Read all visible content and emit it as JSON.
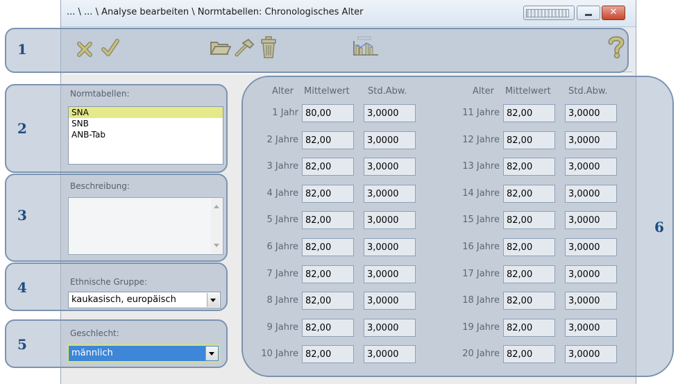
{
  "window": {
    "title": "... \\ ... \\ Analyse bearbeiten \\ Normtabellen: Chronologisches Alter",
    "close_label": "✕"
  },
  "toolbar": {
    "icons": [
      "cancel-x-icon",
      "confirm-check-icon",
      "open-folder-icon",
      "hammer-icon",
      "trash-icon",
      "chart-icon",
      "help-icon"
    ]
  },
  "callouts": [
    "1",
    "2",
    "3",
    "4",
    "5",
    "6"
  ],
  "norm_tables": {
    "label": "Normtabellen:",
    "items": [
      "SNA",
      "SNB",
      "ANB-Tab"
    ],
    "selected": "SNA"
  },
  "description": {
    "label": "Beschreibung:",
    "value": ""
  },
  "ethnic_group": {
    "label": "Ethnische Gruppe:",
    "value": "kaukasisch, europäisch"
  },
  "gender": {
    "label": "Geschlecht:",
    "value": "männlich"
  },
  "table": {
    "headers": {
      "age": "Alter",
      "mean": "Mittelwert",
      "sd": "Std.Abw."
    },
    "left": [
      {
        "age": "1 Jahr",
        "mean": "80,00",
        "sd": "3,0000"
      },
      {
        "age": "2 Jahre",
        "mean": "82,00",
        "sd": "3,0000"
      },
      {
        "age": "3 Jahre",
        "mean": "82,00",
        "sd": "3,0000"
      },
      {
        "age": "4 Jahre",
        "mean": "82,00",
        "sd": "3,0000"
      },
      {
        "age": "5 Jahre",
        "mean": "82,00",
        "sd": "3,0000"
      },
      {
        "age": "6 Jahre",
        "mean": "82,00",
        "sd": "3,0000"
      },
      {
        "age": "7 Jahre",
        "mean": "82,00",
        "sd": "3,0000"
      },
      {
        "age": "8 Jahre",
        "mean": "82,00",
        "sd": "3,0000"
      },
      {
        "age": "9 Jahre",
        "mean": "82,00",
        "sd": "3,0000"
      },
      {
        "age": "10 Jahre",
        "mean": "82,00",
        "sd": "3,0000"
      }
    ],
    "right": [
      {
        "age": "11 Jahre",
        "mean": "82,00",
        "sd": "3,0000"
      },
      {
        "age": "12 Jahre",
        "mean": "82,00",
        "sd": "3,0000"
      },
      {
        "age": "13 Jahre",
        "mean": "82,00",
        "sd": "3,0000"
      },
      {
        "age": "14 Jahre",
        "mean": "82,00",
        "sd": "3,0000"
      },
      {
        "age": "15 Jahre",
        "mean": "82,00",
        "sd": "3,0000"
      },
      {
        "age": "16 Jahre",
        "mean": "82,00",
        "sd": "3,0000"
      },
      {
        "age": "17 Jahre",
        "mean": "82,00",
        "sd": "3,0000"
      },
      {
        "age": "18 Jahre",
        "mean": "82,00",
        "sd": "3,0000"
      },
      {
        "age": "19 Jahre",
        "mean": "82,00",
        "sd": "3,0000"
      },
      {
        "age": "20 Jahre",
        "mean": "82,00",
        "sd": "3,0000"
      }
    ]
  }
}
